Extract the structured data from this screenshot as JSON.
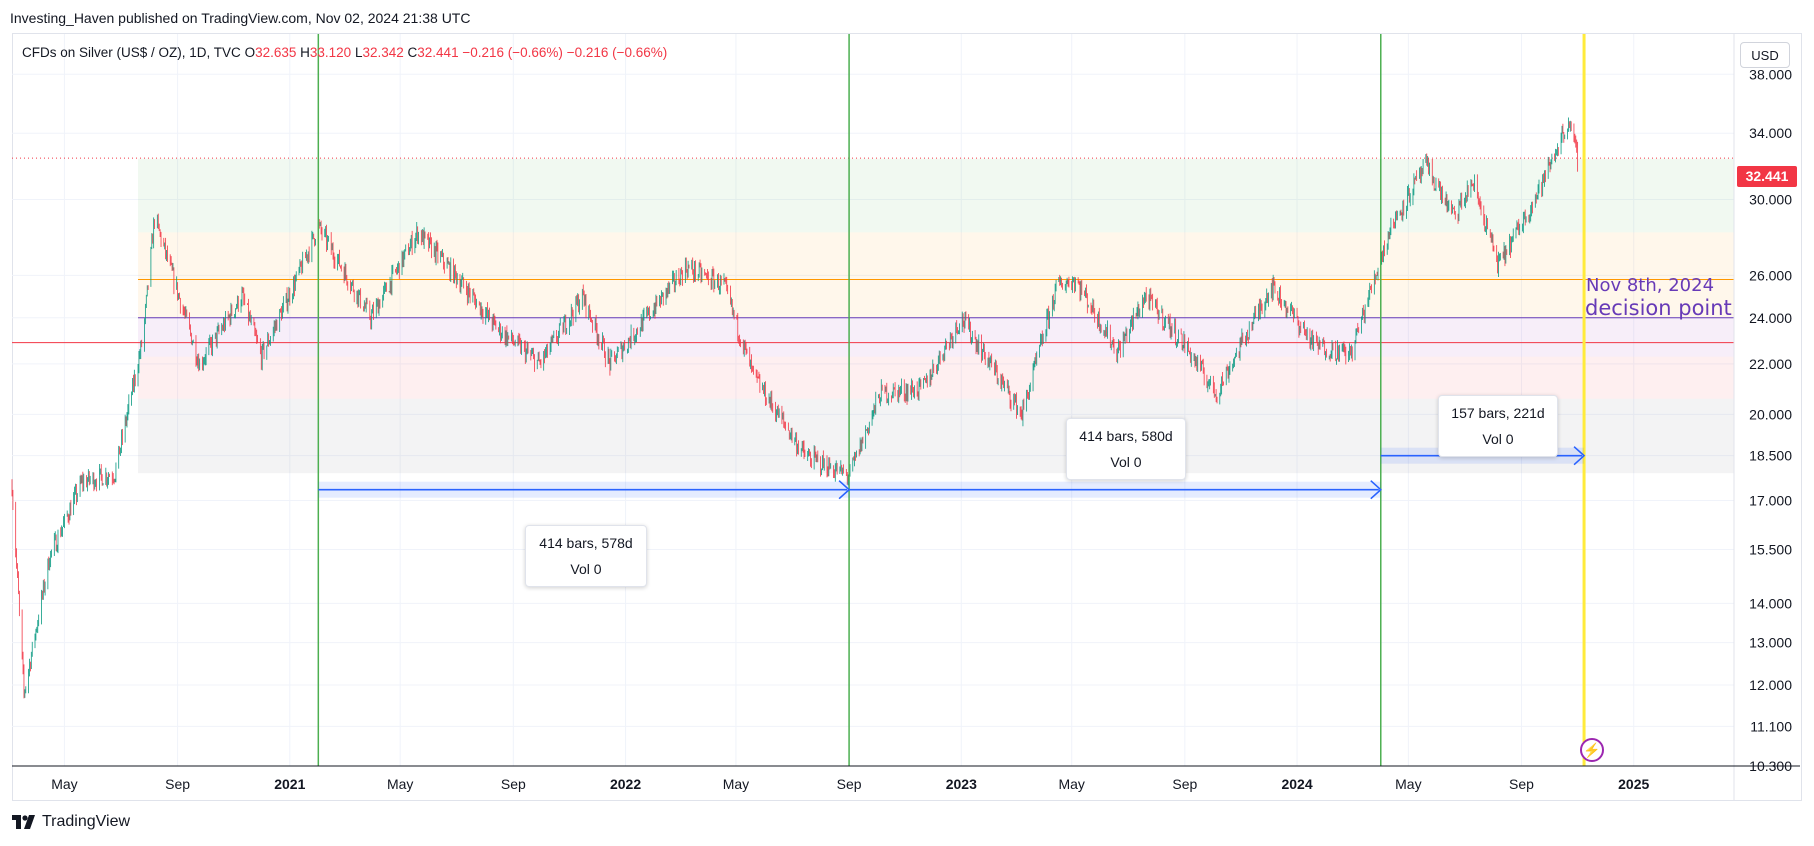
{
  "publisher": {
    "text": "Investing_Haven published on TradingView.com, Nov 02, 2024 21:38 UTC"
  },
  "legend": {
    "symbol": "CFDs on Silver (US$ / OZ), 1D, TVC",
    "open_label": "O",
    "open": "32.635",
    "high_label": "H",
    "high": "33.120",
    "low_label": "L",
    "low": "32.342",
    "close_label": "C",
    "close": "32.441",
    "change": "−0.216 (−0.66%)",
    "change2": "−0.216 (−0.66%)"
  },
  "currency_button": {
    "label": "USD"
  },
  "price_badge": {
    "value": "32.441",
    "color": "#f23645"
  },
  "annotation": {
    "line1": "Nov 8th, 2024",
    "line2": "decision point",
    "color": "#673ab7"
  },
  "measures": [
    {
      "line1": "414 bars, 578d",
      "line2": "Vol 0"
    },
    {
      "line1": "414 bars, 580d",
      "line2": "Vol 0"
    },
    {
      "line1": "157 bars, 221d",
      "line2": "Vol 0"
    }
  ],
  "footer": {
    "logo_text": "TradingView"
  },
  "icons": {
    "lightning": "lightning-icon",
    "logo": "tradingview-logo-icon"
  },
  "colors": {
    "up": "#089981",
    "down": "#f23645",
    "vertical_lines": "#4caf50",
    "decision_line": "#ffeb3b",
    "arrows": "#2962ff"
  },
  "chart_data": {
    "type": "candlestick",
    "symbol": "CFDs on Silver (US$ / OZ), 1D, TVC",
    "y_scale": "log",
    "ylim": [
      10.3,
      41.0
    ],
    "y_ticks": [
      {
        "value": 38.0,
        "label": "38.000"
      },
      {
        "value": 34.0,
        "label": "34.000"
      },
      {
        "value": 30.0,
        "label": "30.000"
      },
      {
        "value": 26.0,
        "label": "26.000"
      },
      {
        "value": 24.0,
        "label": "24.000"
      },
      {
        "value": 22.0,
        "label": "22.000"
      },
      {
        "value": 20.0,
        "label": "20.000"
      },
      {
        "value": 18.5,
        "label": "18.500"
      },
      {
        "value": 17.0,
        "label": "17.000"
      },
      {
        "value": 15.5,
        "label": "15.500"
      },
      {
        "value": 14.0,
        "label": "14.000"
      },
      {
        "value": 13.0,
        "label": "13.000"
      },
      {
        "value": 12.0,
        "label": "12.000"
      },
      {
        "value": 11.1,
        "label": "11.100"
      },
      {
        "value": 10.3,
        "label": "10.300"
      }
    ],
    "xlim": [
      "2020-03-05",
      "2025-04-20"
    ],
    "x_ticks": [
      {
        "date": "2020-05-01",
        "label": "May",
        "bold": false
      },
      {
        "date": "2020-09-01",
        "label": "Sep",
        "bold": false
      },
      {
        "date": "2021-01-01",
        "label": "2021",
        "bold": true
      },
      {
        "date": "2021-05-01",
        "label": "May",
        "bold": false
      },
      {
        "date": "2021-09-01",
        "label": "Sep",
        "bold": false
      },
      {
        "date": "2022-01-01",
        "label": "2022",
        "bold": true
      },
      {
        "date": "2022-05-01",
        "label": "May",
        "bold": false
      },
      {
        "date": "2022-09-01",
        "label": "Sep",
        "bold": false
      },
      {
        "date": "2023-01-01",
        "label": "2023",
        "bold": true
      },
      {
        "date": "2023-05-01",
        "label": "May",
        "bold": false
      },
      {
        "date": "2023-09-01",
        "label": "Sep",
        "bold": false
      },
      {
        "date": "2024-01-01",
        "label": "2024",
        "bold": true
      },
      {
        "date": "2024-05-01",
        "label": "May",
        "bold": false
      },
      {
        "date": "2024-09-01",
        "label": "Sep",
        "bold": false
      },
      {
        "date": "2025-01-01",
        "label": "2025",
        "bold": true
      }
    ],
    "price_path": [
      {
        "date": "2020-03-05",
        "price": 17.5
      },
      {
        "date": "2020-03-18",
        "price": 11.8
      },
      {
        "date": "2020-04-15",
        "price": 15.3
      },
      {
        "date": "2020-05-20",
        "price": 17.6
      },
      {
        "date": "2020-06-25",
        "price": 17.9
      },
      {
        "date": "2020-07-25",
        "price": 23.0
      },
      {
        "date": "2020-08-07",
        "price": 29.0
      },
      {
        "date": "2020-09-25",
        "price": 22.0
      },
      {
        "date": "2020-11-10",
        "price": 25.0
      },
      {
        "date": "2020-12-01",
        "price": 22.3
      },
      {
        "date": "2021-01-10",
        "price": 26.0
      },
      {
        "date": "2021-02-01",
        "price": 28.5
      },
      {
        "date": "2021-03-30",
        "price": 24.0
      },
      {
        "date": "2021-05-20",
        "price": 28.2
      },
      {
        "date": "2021-06-30",
        "price": 26.0
      },
      {
        "date": "2021-08-15",
        "price": 23.5
      },
      {
        "date": "2021-09-30",
        "price": 22.0
      },
      {
        "date": "2021-11-15",
        "price": 25.0
      },
      {
        "date": "2021-12-15",
        "price": 22.0
      },
      {
        "date": "2022-03-08",
        "price": 26.4
      },
      {
        "date": "2022-04-18",
        "price": 25.5
      },
      {
        "date": "2022-05-20",
        "price": 21.5
      },
      {
        "date": "2022-07-15",
        "price": 18.5
      },
      {
        "date": "2022-09-01",
        "price": 17.8
      },
      {
        "date": "2022-10-05",
        "price": 20.8
      },
      {
        "date": "2022-11-20",
        "price": 21.0
      },
      {
        "date": "2023-01-01",
        "price": 24.0
      },
      {
        "date": "2023-03-08",
        "price": 20.0
      },
      {
        "date": "2023-04-15",
        "price": 25.5
      },
      {
        "date": "2023-05-05",
        "price": 25.8
      },
      {
        "date": "2023-06-20",
        "price": 22.5
      },
      {
        "date": "2023-07-20",
        "price": 25.0
      },
      {
        "date": "2023-09-01",
        "price": 22.8
      },
      {
        "date": "2023-10-05",
        "price": 20.8
      },
      {
        "date": "2023-12-04",
        "price": 25.5
      },
      {
        "date": "2024-01-20",
        "price": 22.8
      },
      {
        "date": "2024-02-28",
        "price": 22.4
      },
      {
        "date": "2024-04-12",
        "price": 28.5
      },
      {
        "date": "2024-05-20",
        "price": 32.0
      },
      {
        "date": "2024-06-20",
        "price": 29.0
      },
      {
        "date": "2024-07-10",
        "price": 31.0
      },
      {
        "date": "2024-08-07",
        "price": 26.5
      },
      {
        "date": "2024-09-20",
        "price": 30.5
      },
      {
        "date": "2024-10-22",
        "price": 34.8
      },
      {
        "date": "2024-11-01",
        "price": 32.441
      }
    ],
    "bands": [
      {
        "from": 28.2,
        "to": 32.4,
        "color": "rgba(76,175,80,0.08)",
        "start": "2020-07-20"
      },
      {
        "from": 24.0,
        "to": 28.2,
        "color": "rgba(255,152,0,0.08)",
        "start": "2020-07-20"
      },
      {
        "from": 22.3,
        "to": 24.0,
        "color": "rgba(156,39,176,0.08)",
        "start": "2020-07-20"
      },
      {
        "from": 20.6,
        "to": 22.3,
        "color": "rgba(242,54,69,0.08)",
        "start": "2020-07-20"
      },
      {
        "from": 17.9,
        "to": 20.6,
        "color": "rgba(120,123,134,0.09)",
        "start": "2020-07-20"
      }
    ],
    "horizontal_lines": [
      {
        "price": 32.441,
        "color": "#f23645",
        "dotted": true,
        "start": "2020-03-05"
      },
      {
        "price": 25.8,
        "color": "#ff9800",
        "dotted": false,
        "start": "2020-07-20"
      },
      {
        "price": 24.0,
        "color": "#673ab7",
        "dotted": false,
        "start": "2020-07-20"
      },
      {
        "price": 22.9,
        "color": "#f23645",
        "dotted": false,
        "start": "2020-03-05"
      }
    ],
    "vertical_lines": [
      "2021-02-01",
      "2022-09-01",
      "2024-04-01"
    ],
    "decision_line": "2024-11-08",
    "measure_ranges": [
      {
        "from": "2021-02-01",
        "to": "2022-09-01",
        "price": 17.35
      },
      {
        "from": "2022-09-01",
        "to": "2024-04-01",
        "price": 17.35
      },
      {
        "from": "2024-04-01",
        "to": "2024-11-08",
        "price": 18.5
      }
    ]
  }
}
